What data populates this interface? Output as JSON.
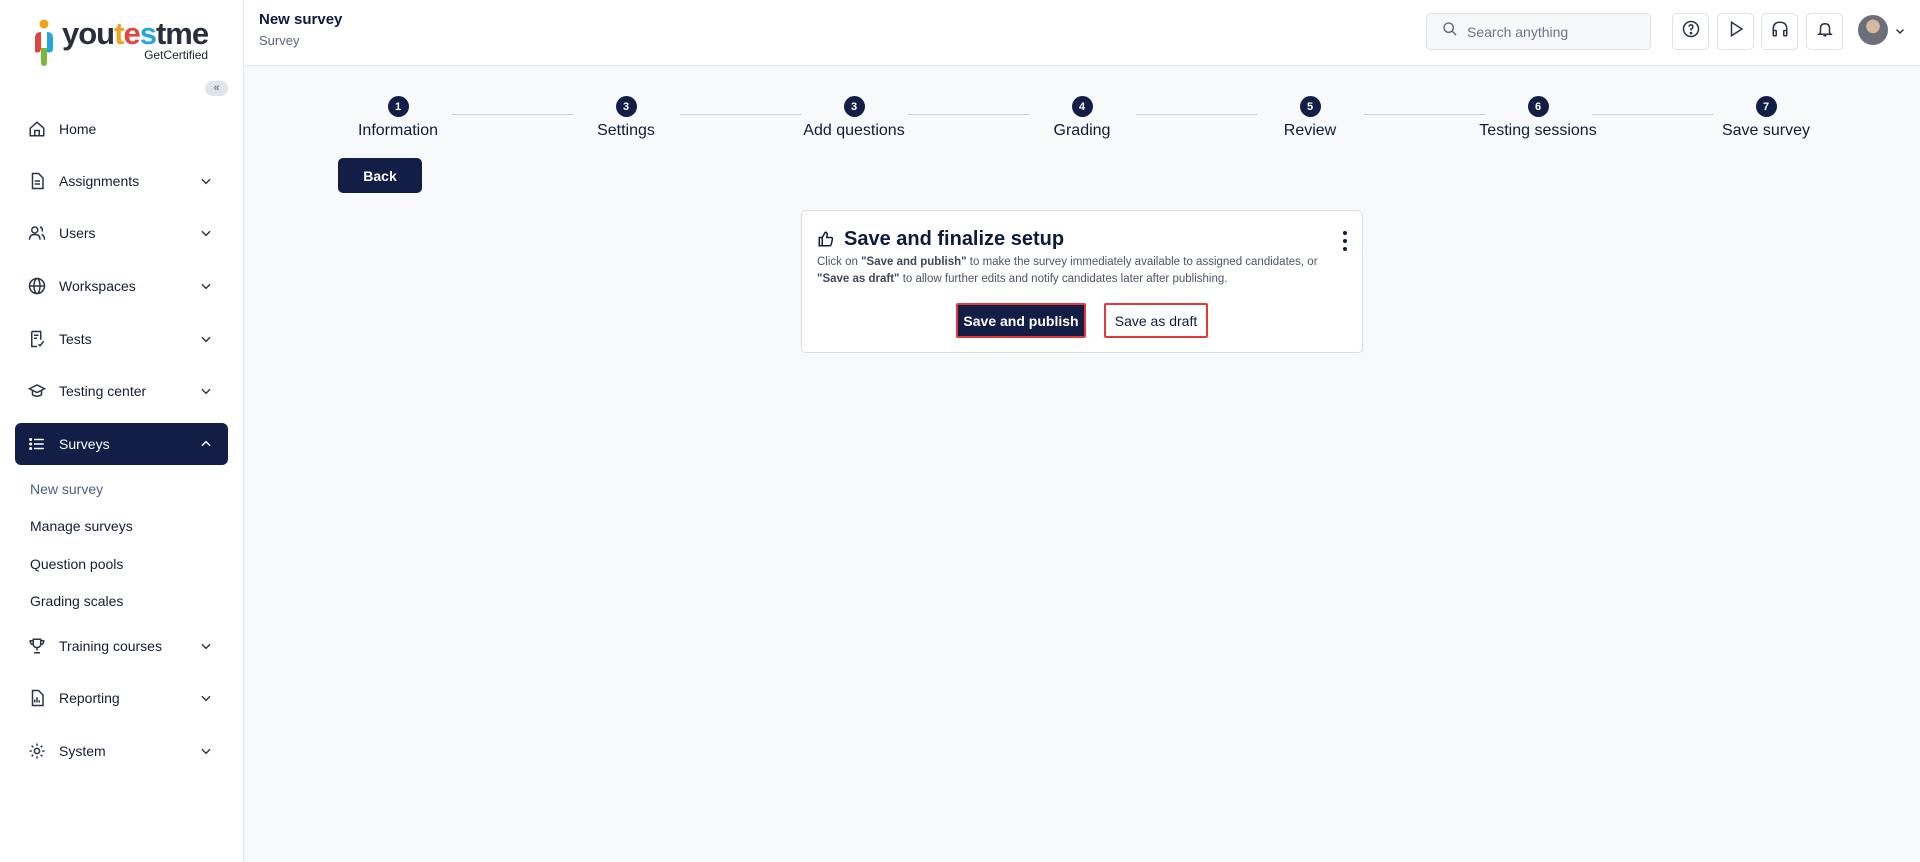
{
  "brand": {
    "logo_parts": [
      "you",
      "t",
      "e",
      "s",
      "tme"
    ],
    "logo_sub": "GetCertified"
  },
  "sidebar": {
    "collapse_glyph": "«",
    "items": [
      {
        "label": "Home",
        "icon": "home-icon"
      },
      {
        "label": "Assignments",
        "icon": "document-icon"
      },
      {
        "label": "Users",
        "icon": "users-icon"
      },
      {
        "label": "Workspaces",
        "icon": "globe-icon"
      },
      {
        "label": "Tests",
        "icon": "test-icon"
      },
      {
        "label": "Testing center",
        "icon": "graduation-cap-icon"
      },
      {
        "label": "Surveys",
        "icon": "list-icon"
      },
      {
        "label": "Training courses",
        "icon": "trophy-icon"
      },
      {
        "label": "Reporting",
        "icon": "report-icon"
      },
      {
        "label": "System",
        "icon": "gear-icon"
      }
    ],
    "survey_subitems": [
      "New survey",
      "Manage surveys",
      "Question pools",
      "Grading scales"
    ]
  },
  "header": {
    "title": "New survey",
    "subtitle": "Survey",
    "search_placeholder": "Search anything"
  },
  "stepper": {
    "steps": [
      {
        "num": "1",
        "label": "Information"
      },
      {
        "num": "3",
        "label": "Settings"
      },
      {
        "num": "3",
        "label": "Add questions"
      },
      {
        "num": "4",
        "label": "Grading"
      },
      {
        "num": "5",
        "label": "Review"
      },
      {
        "num": "6",
        "label": "Testing sessions"
      },
      {
        "num": "7",
        "label": "Save survey"
      }
    ]
  },
  "actions": {
    "back_label": "Back"
  },
  "card": {
    "title": "Save and finalize setup",
    "desc_1": "Click on ",
    "desc_publish": "\"Save and publish\"",
    "desc_2": " to make the survey immediately available to assigned candidates, or ",
    "desc_draft": "\"Save as draft\"",
    "desc_3": " to allow further edits and notify candidates later after publishing.",
    "publish_label": "Save and publish",
    "draft_label": "Save as draft"
  },
  "colors": {
    "primary": "#121e45",
    "highlight": "#e23a3a"
  }
}
